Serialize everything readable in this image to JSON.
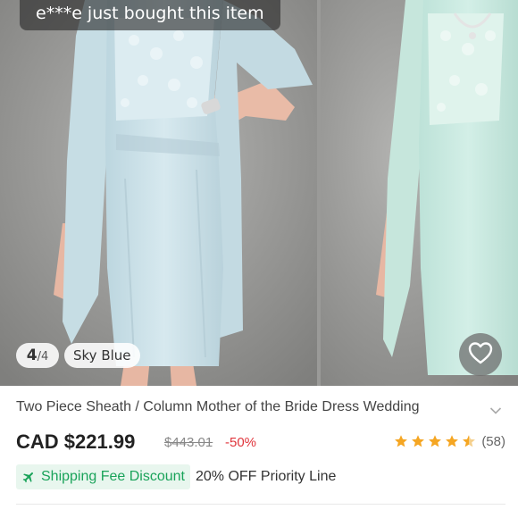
{
  "gallery": {
    "notice": "e***e just bought this item",
    "counter_current": "4",
    "counter_total": "/4",
    "color_label": "Sky Blue",
    "wishlist_icon": "heart-icon"
  },
  "product": {
    "title": "Two Piece Sheath / Column Mother of the Bride Dress Wedding",
    "price": "CAD $221.99",
    "original_price": "$443.01",
    "discount": "-50%",
    "rating": 4.5,
    "rating_count": "(58)",
    "shipping_badge": "Shipping Fee Discount",
    "shipping_text": "20% OFF Priority Line",
    "icons": [
      "chevron-down-icon",
      "star-icon",
      "plane-icon"
    ]
  },
  "colors": {
    "accent_green": "#1aa35a",
    "badge_bg": "#e8f6ee",
    "discount_red": "#e0353c",
    "star_orange": "#f5a623",
    "dress_blue": "#cfe3ea",
    "dress_mint": "#cdeae2"
  }
}
